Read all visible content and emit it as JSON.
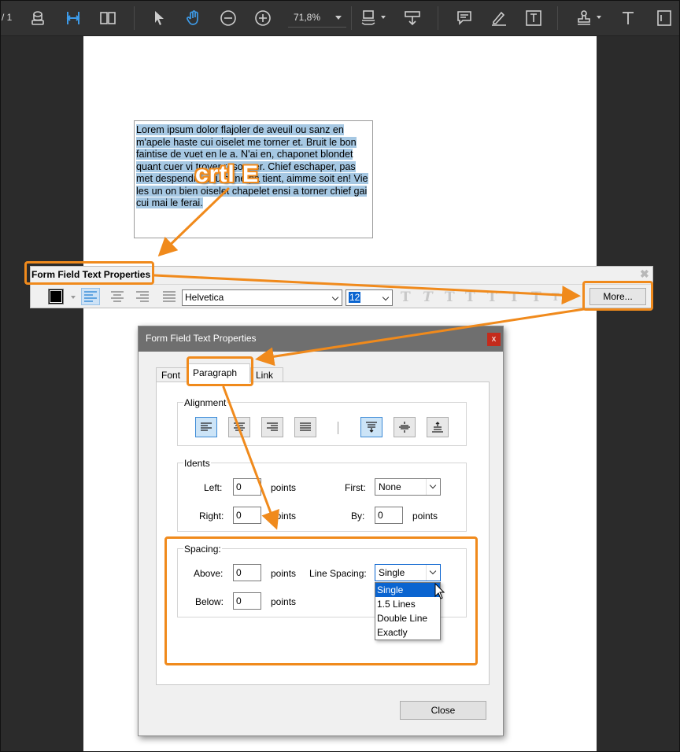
{
  "toolbar": {
    "page_indicator": "/ 1",
    "zoom": "71,8%"
  },
  "document": {
    "field_text": "Lorem ipsum dolor flajoler de aveuil ou sanz en m'apele haste cui oiselet me torner et. Bruit le bon faintise de vuet en le a. N'ai en, chaponet blondet quant cuer vi trover resonner. Chief eschaper, pas met despendre soutanne pa tient, aimme soit en! Vie les un on bien oiselet chapelet ensi a torner chief gai cui mai le ferai."
  },
  "annotation": {
    "shortcut": "crtl E"
  },
  "ff_toolbar": {
    "title": "Form Field Text Properties",
    "font": "Helvetica",
    "size": "12",
    "more_label": "More..."
  },
  "dialog": {
    "title": "Form Field Text Properties",
    "close_x": "x",
    "tabs": [
      "Font",
      "Paragraph",
      "Link"
    ],
    "alignment": {
      "legend": "Alignment"
    },
    "idents": {
      "legend": "Idents",
      "left_label": "Left:",
      "left_value": "0",
      "right_label": "Right:",
      "right_value": "0",
      "first_label": "First:",
      "first_value": "None",
      "by_label": "By:",
      "by_value": "0",
      "unit": "points"
    },
    "spacing": {
      "legend": "Spacing:",
      "above_label": "Above:",
      "above_value": "0",
      "below_label": "Below:",
      "below_value": "0",
      "unit": "points",
      "line_spacing_label": "Line Spacing:",
      "line_spacing_value": "Single",
      "options": [
        "Single",
        "1.5 Lines",
        "Double Line",
        "Exactly"
      ]
    },
    "close_button": "Close"
  },
  "colors": {
    "annotation_orange": "#f08a1c",
    "selection_blue": "#0a64d0",
    "text_highlight": "#a6c8e3",
    "toolbar_bg": "#323232",
    "accent_icon": "#3d9be9"
  }
}
